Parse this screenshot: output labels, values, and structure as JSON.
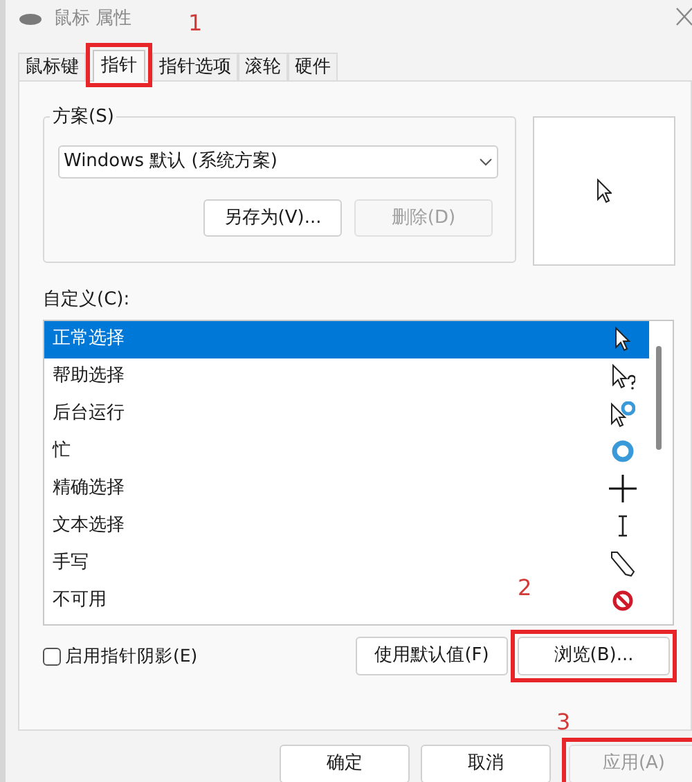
{
  "window": {
    "title": "鼠标 属性"
  },
  "tabs": [
    {
      "label": "鼠标键",
      "selected": false
    },
    {
      "label": "指针",
      "selected": true,
      "highlighted": true
    },
    {
      "label": "指针选项",
      "selected": false
    },
    {
      "label": "滚轮",
      "selected": false
    },
    {
      "label": "硬件",
      "selected": false
    }
  ],
  "scheme": {
    "label": "方案(S)",
    "value": "Windows 默认 (系统方案)",
    "buttons": [
      {
        "label": "另存为(V)...",
        "disabled": false
      },
      {
        "label": "删除(D)",
        "disabled": true
      }
    ]
  },
  "customize": {
    "label": "自定义(C):",
    "items": [
      {
        "name": "正常选择",
        "kind": "arrow",
        "selected": true
      },
      {
        "name": "帮助选择",
        "kind": "help",
        "selected": false
      },
      {
        "name": "后台运行",
        "kind": "working",
        "selected": false
      },
      {
        "name": "忙",
        "kind": "busy",
        "selected": false
      },
      {
        "name": "精确选择",
        "kind": "precision",
        "selected": false
      },
      {
        "name": "文本选择",
        "kind": "text",
        "selected": false
      },
      {
        "name": "手写",
        "kind": "handwriting",
        "selected": false
      },
      {
        "name": "不可用",
        "kind": "unavailable",
        "selected": false
      }
    ]
  },
  "shadow_checkbox": {
    "label": "启用指针阴影(E)",
    "checked": false
  },
  "list_buttons": [
    {
      "label": "使用默认值(F)"
    },
    {
      "label": "浏览(B)...",
      "highlighted": true
    }
  ],
  "dialog_buttons": [
    {
      "label": "确定",
      "disabled": false
    },
    {
      "label": "取消",
      "disabled": false
    },
    {
      "label": "应用(A)",
      "disabled": true,
      "highlighted": true
    }
  ],
  "annotations": [
    {
      "label": "1"
    },
    {
      "label": "2"
    },
    {
      "label": "3"
    }
  ]
}
